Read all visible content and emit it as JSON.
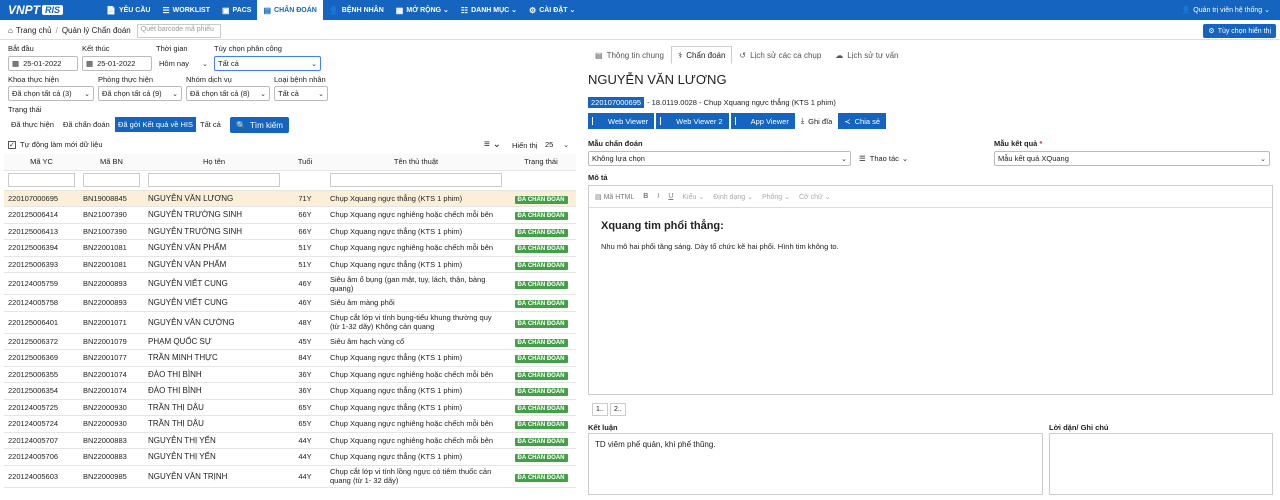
{
  "app": {
    "logo": "VNPT",
    "logo_sub": "RIS"
  },
  "nav": [
    {
      "icon": "📄",
      "label": "YÊU CẦU"
    },
    {
      "icon": "☰",
      "label": "WORKLIST"
    },
    {
      "icon": "▣",
      "label": "PACS"
    },
    {
      "icon": "▤",
      "label": "CHẨN ĐOÁN"
    },
    {
      "icon": "👤",
      "label": "BỆNH NHÂN"
    },
    {
      "icon": "▦",
      "label": "MỞ RỘNG ⌄"
    },
    {
      "icon": "☷",
      "label": "DANH MỤC ⌄"
    },
    {
      "icon": "⚙",
      "label": "CÀI ĐẶT ⌄"
    }
  ],
  "user": "Quản trị viên hệ thống ⌄",
  "breadcrumb": {
    "home": "Trang chủ",
    "page": "Quản lý Chẩn đoán",
    "barcode_placeholder": "Quét barcode mã phiếu"
  },
  "custom_view": "Tùy chọn hiển thị",
  "filters": {
    "start_label": "Bắt đầu",
    "start": "25-01-2022",
    "end_label": "Kết thúc",
    "end": "25-01-2022",
    "time_label": "Thời gian",
    "time": "Hôm nay",
    "assign_label": "Tùy chọn phân công",
    "assign": "Tất cả",
    "dept_label": "Khoa thực hiện",
    "dept": "Đã chọn tất cả (3)",
    "room_label": "Phòng thực hiện",
    "room": "Đã chọn tất cả (9)",
    "group_label": "Nhóm dịch vụ",
    "group": "Đã chọn tất cả (8)",
    "ptype_label": "Loại bệnh nhân",
    "ptype": "Tất cả",
    "status_label": "Trạng thái",
    "status_tabs": [
      "Đã thực hiện",
      "Đã chẩn đoán",
      "Đã gởi Kết quả về HIS",
      "Tất cả"
    ],
    "search": "Tìm kiếm",
    "auto_refresh": "Tự động làm mới dữ liệu",
    "show_label": "Hiển thị",
    "show": "25"
  },
  "table": {
    "headers": [
      "Mã YC",
      "Mã BN",
      "Họ tên",
      "Tuổi",
      "Tên thủ thuật",
      "Trạng thái"
    ],
    "rows": [
      [
        "220107000695",
        "BN19008845",
        "NGUYỄN VĂN LƯƠNG",
        "71Y",
        "Chụp Xquang ngực thẳng (KTS 1 phim)",
        "ĐÃ CHẨN ĐOÁN"
      ],
      [
        "220125006414",
        "BN21007390",
        "NGUYỄN TRƯỜNG SINH",
        "66Y",
        "Chụp Xquang ngực nghiêng hoặc chếch mỗi bên",
        "ĐÃ CHẨN ĐOÁN"
      ],
      [
        "220125006413",
        "BN21007390",
        "NGUYỄN TRƯỜNG SINH",
        "66Y",
        "Chụp Xquang ngực thẳng (KTS 1 phim)",
        "ĐÃ CHẨN ĐOÁN"
      ],
      [
        "220125006394",
        "BN22001081",
        "NGUYỄN VĂN PHẨM",
        "51Y",
        "Chụp Xquang ngực nghiêng hoặc chếch mỗi bên",
        "ĐÃ CHẨN ĐOÁN"
      ],
      [
        "220125006393",
        "BN22001081",
        "NGUYỄN VĂN PHẨM",
        "51Y",
        "Chụp Xquang ngực thẳng (KTS 1 phim)",
        "ĐÃ CHẨN ĐOÁN"
      ],
      [
        "220124005759",
        "BN22000893",
        "NGUYỄN VIẾT CUNG",
        "46Y",
        "Siêu âm ổ bụng (gan mật, tụy, lách, thận, bàng quang)",
        "ĐÃ CHẨN ĐOÁN"
      ],
      [
        "220124005758",
        "BN22000893",
        "NGUYỄN VIẾT CUNG",
        "46Y",
        "Siêu âm màng phổi",
        "ĐÃ CHẨN ĐOÁN"
      ],
      [
        "220125006401",
        "BN22001071",
        "NGUYỄN VĂN CƯỜNG",
        "48Y",
        "Chụp cắt lớp vi tính bụng-tiểu khung thường quy (từ 1-32 dãy) Không cản quang",
        "ĐÃ CHẨN ĐOÁN"
      ],
      [
        "220125006372",
        "BN22001079",
        "PHẠM QUỐC SỰ",
        "45Y",
        "Siêu âm hạch vùng cổ",
        "ĐÃ CHẨN ĐOÁN"
      ],
      [
        "220125006369",
        "BN22001077",
        "TRẦN MINH THỰC",
        "84Y",
        "Chụp Xquang ngực thẳng (KTS 1 phim)",
        "ĐÃ CHẨN ĐOÁN"
      ],
      [
        "220125006355",
        "BN22001074",
        "ĐÀO THỊ BÌNH",
        "36Y",
        "Chụp Xquang ngực nghiêng hoặc chếch mỗi bên",
        "ĐÃ CHẨN ĐOÁN"
      ],
      [
        "220125006354",
        "BN22001074",
        "ĐÀO THỊ BÌNH",
        "36Y",
        "Chụp Xquang ngực thẳng (KTS 1 phim)",
        "ĐÃ CHẨN ĐOÁN"
      ],
      [
        "220124005725",
        "BN22000930",
        "TRẦN THỊ DẬU",
        "65Y",
        "Chụp Xquang ngực thẳng (KTS 1 phim)",
        "ĐÃ CHẨN ĐOÁN"
      ],
      [
        "220124005724",
        "BN22000930",
        "TRẦN THỊ DẬU",
        "65Y",
        "Chụp Xquang ngực nghiêng hoặc chếch mỗi bên",
        "ĐÃ CHẨN ĐOÁN"
      ],
      [
        "220124005707",
        "BN22000883",
        "NGUYỄN THỊ YẾN",
        "44Y",
        "Chụp Xquang ngực nghiêng hoặc chếch mỗi bên",
        "ĐÃ CHẨN ĐOÁN"
      ],
      [
        "220124005706",
        "BN22000883",
        "NGUYỄN THỊ YẾN",
        "44Y",
        "Chụp Xquang ngực thẳng (KTS 1 phim)",
        "ĐÃ CHẨN ĐOÁN"
      ],
      [
        "220124005603",
        "BN22000985",
        "NGUYỄN VĂN TRỊNH",
        "44Y",
        "Chụp cắt lớp vi tính lồng ngực có tiêm thuốc cản quang (từ 1- 32 dãy)",
        "ĐÃ CHẨN ĐOÁN"
      ]
    ]
  },
  "detail": {
    "tabs": [
      "Thông tin chung",
      "Chẩn đoán",
      "Lịch sử các ca chụp",
      "Lịch sử tư vấn"
    ],
    "patient": "NGUYỄN VĂN LƯƠNG",
    "order_id": "220107000695",
    "order_desc": "- 18.0119.0028 - Chụp Xquang ngực thẳng (KTS 1 phim)",
    "buttons": [
      "Web Viewer",
      "Web Viewer 2",
      "App Viewer",
      "Ghi đĩa",
      "Chia sẻ"
    ],
    "diag_template_label": "Mẫu chẩn đoán",
    "diag_template": "Không lựa chọn",
    "actions": "Thao tác",
    "result_template_label": "Mẫu kết quả",
    "result_template": "Mẫu kết quả XQuang",
    "desc_label": "Mô tả",
    "toolbar": [
      "Mã HTML",
      "B",
      "I",
      "U",
      "Kiểu",
      "Định dạng",
      "Phông",
      "Cỡ chữ"
    ],
    "content_title": "Xquang tim phổi thẳng:",
    "content_text": "Nhu mô hai phổi tăng sáng. Dày tổ chức kẽ hai phổi. Hình tim không to.",
    "pages": [
      "1..",
      "2.."
    ],
    "conclusion_label": "Kết luận",
    "conclusion": "TD viêm phế quản, khí phế thũng.",
    "note_label": "Lời dặn/ Ghi chú"
  }
}
